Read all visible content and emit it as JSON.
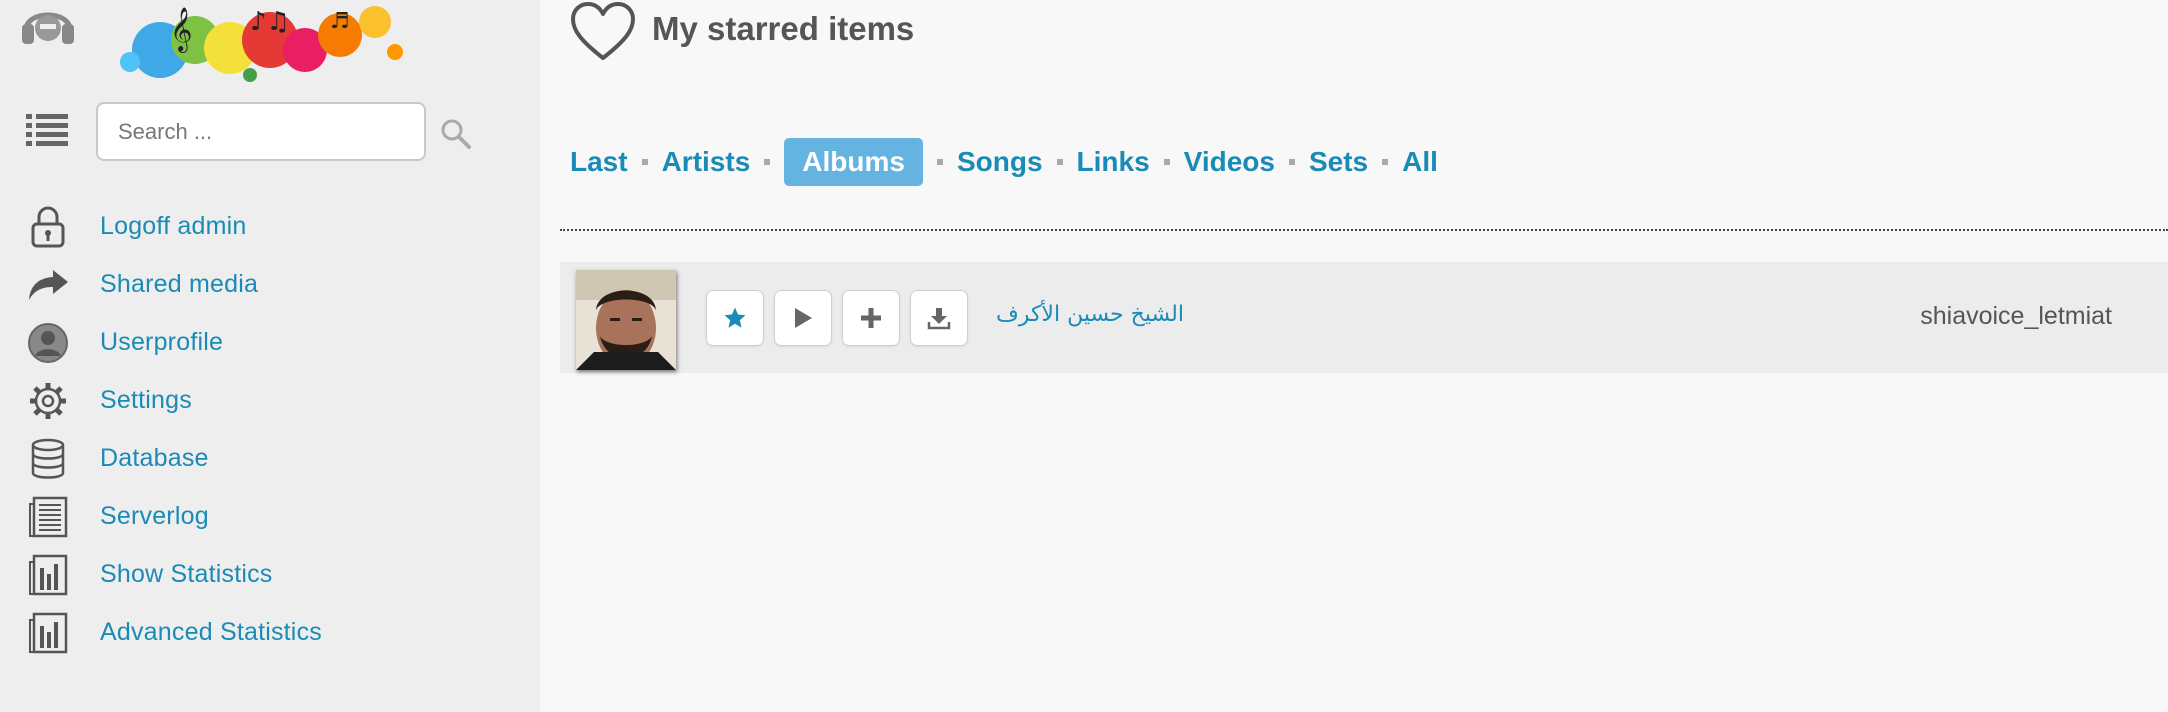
{
  "sidebar": {
    "search": {
      "placeholder": "Search ..."
    },
    "items": [
      {
        "label": "Logoff admin",
        "icon": "lock-icon"
      },
      {
        "label": "Shared media",
        "icon": "share-icon"
      },
      {
        "label": "Userprofile",
        "icon": "user-icon"
      },
      {
        "label": "Settings",
        "icon": "gear-icon"
      },
      {
        "label": "Database",
        "icon": "database-icon"
      },
      {
        "label": "Serverlog",
        "icon": "log-icon"
      },
      {
        "label": "Show Statistics",
        "icon": "statistics-icon"
      },
      {
        "label": "Advanced Statistics",
        "icon": "statistics-icon"
      }
    ]
  },
  "main": {
    "title": "My starred items",
    "tabs": [
      {
        "label": "Last",
        "active": false
      },
      {
        "label": "Artists",
        "active": false
      },
      {
        "label": "Albums",
        "active": true
      },
      {
        "label": "Songs",
        "active": false
      },
      {
        "label": "Links",
        "active": false
      },
      {
        "label": "Videos",
        "active": false
      },
      {
        "label": "Sets",
        "active": false
      },
      {
        "label": "All",
        "active": false
      }
    ],
    "albums": [
      {
        "title": "الشيخ حسين الأكرف",
        "artist": "shiavoice_letmiat"
      }
    ]
  },
  "colors": {
    "accent": "#1a8bb7",
    "active_tab_bg": "#64b3e0",
    "sidebar_bg": "#eeeeee",
    "row_bg": "#ececec"
  }
}
